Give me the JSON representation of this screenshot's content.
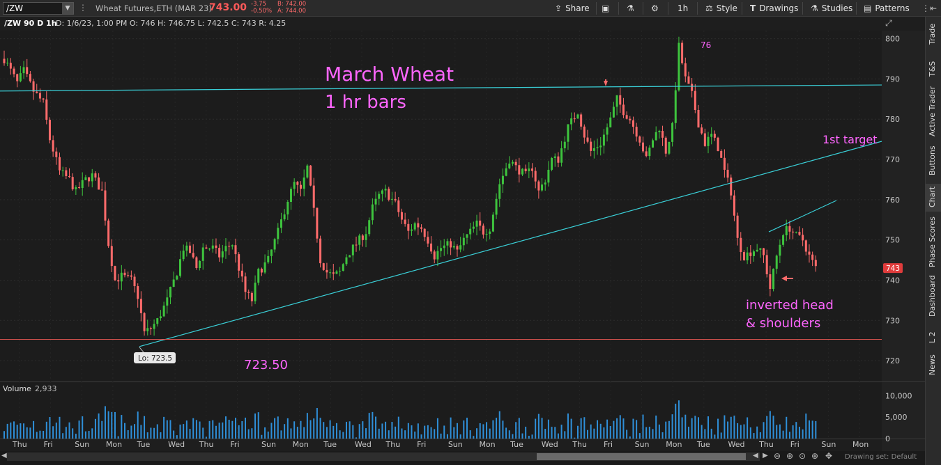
{
  "toolbar": {
    "symbol": "/ZW",
    "description": "Wheat Futures,ETH (MAR 23)",
    "last": "743.00",
    "change": "-3.75",
    "change_pct": "-0.50%",
    "bid": "B: 742.00",
    "ask": "A: 744.00",
    "share_label": "Share",
    "timeframe_label": "1h",
    "style_label": "Style",
    "drawings_label": "Drawings",
    "studies_label": "Studies",
    "patterns_label": "Patterns"
  },
  "info_bar": {
    "symbol": "/ZW 90 D 1h",
    "ohlc": "D: 1/6/23, 1:00 PM  O: 746  H: 746.75  L: 742.5  C: 743  R: 4.25"
  },
  "side_tabs": [
    "Trade",
    "T&S",
    "Active Trader",
    "Buttons",
    "Chart",
    "Phase Scores",
    "Dashboard",
    "L 2",
    "News"
  ],
  "annotations": {
    "title_line1": "March Wheat",
    "title_line2": "1 hr bars",
    "peak_label": "76",
    "target_label": "1st target",
    "pattern_line1": "inverted head",
    "pattern_line2": "& shoulders",
    "low_value": "723.50",
    "lo_bubble": "Lo: 723.5",
    "last_price_tag": "743"
  },
  "volume": {
    "label": "Volume",
    "value": "2,933"
  },
  "bottom": {
    "drawing_set": "Drawing set: Default"
  },
  "colors": {
    "up": "#3ec43e",
    "down": "#ff6b6b",
    "trendline": "#3ad0d8",
    "annotation": "#ff66ff",
    "support": "#d9534f",
    "volume": "#2f8fd8"
  },
  "chart_data": {
    "type": "candlestick",
    "ylim": [
      715,
      802
    ],
    "y_ticks": [
      720,
      730,
      740,
      750,
      760,
      770,
      780,
      790,
      800
    ],
    "x_ticks": [
      "Thu",
      "Fri",
      "Sun",
      "Mon",
      "Tue",
      "Wed",
      "Thu",
      "Fri",
      "Sun",
      "Mon",
      "Tue",
      "Wed",
      "Thu",
      "Fri",
      "Sun",
      "Mon",
      "Tue",
      "Wed",
      "Thu",
      "Fri",
      "Sun",
      "Mon",
      "Tue",
      "Wed",
      "Thu",
      "Fri",
      "Sun",
      "Mon"
    ],
    "volume_ticks": [
      "10,000",
      "5,000",
      "0"
    ],
    "volume_max": 12000,
    "price_path": [
      [
        0,
        795
      ],
      [
        4,
        789
      ],
      [
        6,
        792
      ],
      [
        9,
        787
      ],
      [
        12,
        784
      ],
      [
        14,
        775
      ],
      [
        17,
        767
      ],
      [
        20,
        765
      ],
      [
        22,
        762
      ],
      [
        25,
        765
      ],
      [
        27,
        766
      ],
      [
        30,
        762
      ],
      [
        32,
        749
      ],
      [
        34,
        740
      ],
      [
        36,
        741
      ],
      [
        39,
        740
      ],
      [
        41,
        736
      ],
      [
        43,
        727
      ],
      [
        45,
        728
      ],
      [
        47,
        730
      ],
      [
        50,
        735
      ],
      [
        53,
        742
      ],
      [
        55,
        748
      ],
      [
        57,
        747
      ],
      [
        59,
        743
      ],
      [
        61,
        748
      ],
      [
        64,
        748
      ],
      [
        66,
        746
      ],
      [
        68,
        748
      ],
      [
        70,
        749
      ],
      [
        72,
        743
      ],
      [
        74,
        737
      ],
      [
        76,
        735
      ],
      [
        78,
        742
      ],
      [
        81,
        745
      ],
      [
        84,
        752
      ],
      [
        87,
        760
      ],
      [
        89,
        764
      ],
      [
        91,
        762
      ],
      [
        93,
        768
      ],
      [
        95,
        757
      ],
      [
        97,
        745
      ],
      [
        99,
        742
      ],
      [
        101,
        741
      ],
      [
        103,
        742
      ],
      [
        105,
        746
      ],
      [
        108,
        749
      ],
      [
        111,
        752
      ],
      [
        113,
        758
      ],
      [
        115,
        761
      ],
      [
        117,
        762
      ],
      [
        120,
        759
      ],
      [
        122,
        755
      ],
      [
        124,
        752
      ],
      [
        126,
        754
      ],
      [
        128,
        753
      ],
      [
        130,
        750
      ],
      [
        132,
        746
      ],
      [
        134,
        748
      ],
      [
        137,
        749
      ],
      [
        139,
        747
      ],
      [
        141,
        750
      ],
      [
        143,
        752
      ],
      [
        145,
        754
      ],
      [
        147,
        752
      ],
      [
        149,
        753
      ],
      [
        152,
        764
      ],
      [
        155,
        770
      ],
      [
        157,
        768
      ],
      [
        160,
        766
      ],
      [
        162,
        768
      ],
      [
        164,
        762
      ],
      [
        166,
        765
      ],
      [
        168,
        770
      ],
      [
        170,
        770
      ],
      [
        173,
        778
      ],
      [
        176,
        782
      ],
      [
        178,
        776
      ],
      [
        180,
        772
      ],
      [
        183,
        774
      ],
      [
        186,
        780
      ],
      [
        188,
        785
      ],
      [
        190,
        782
      ],
      [
        192,
        780
      ],
      [
        195,
        775
      ],
      [
        197,
        770
      ],
      [
        199,
        775
      ],
      [
        201,
        778
      ],
      [
        203,
        772
      ],
      [
        205,
        778
      ],
      [
        207,
        798
      ],
      [
        209,
        790
      ],
      [
        211,
        786
      ],
      [
        213,
        779
      ],
      [
        215,
        774
      ],
      [
        217,
        776
      ],
      [
        219,
        773
      ],
      [
        221,
        767
      ],
      [
        223,
        762
      ],
      [
        225,
        750
      ],
      [
        227,
        746
      ],
      [
        229,
        747
      ],
      [
        231,
        748
      ],
      [
        233,
        746
      ],
      [
        235,
        738
      ],
      [
        237,
        746
      ],
      [
        239,
        752
      ],
      [
        241,
        753
      ],
      [
        243,
        751
      ],
      [
        245,
        750
      ],
      [
        247,
        746
      ],
      [
        249,
        743
      ]
    ],
    "highlights": {
      "low": 723.5,
      "peak": 799,
      "resistance": 788.5,
      "support_line": 725.3,
      "last_price": 743
    }
  }
}
